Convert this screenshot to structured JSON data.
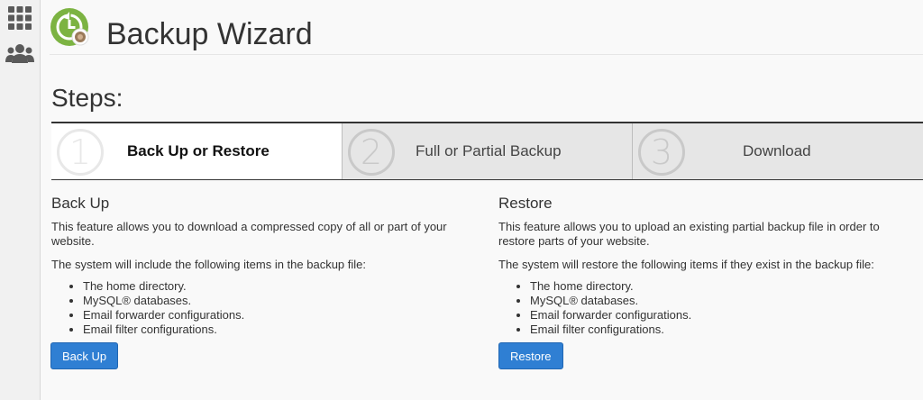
{
  "header": {
    "title": "Backup Wizard"
  },
  "sidebar": {
    "icons": [
      "apps-grid-icon",
      "users-icon"
    ]
  },
  "steps": {
    "title": "Steps:",
    "items": [
      {
        "number": "1",
        "label": "Back Up or Restore",
        "active": true
      },
      {
        "number": "2",
        "label": "Full or Partial Backup",
        "active": false
      },
      {
        "number": "3",
        "label": "Download",
        "active": false
      }
    ]
  },
  "backup": {
    "title": "Back Up",
    "description": "This feature allows you to download a compressed copy of all or part of your website.",
    "intro": "The system will include the following items in the backup file:",
    "items": [
      "The home directory.",
      "MySQL® databases.",
      "Email forwarder configurations.",
      "Email filter configurations."
    ],
    "button": "Back Up"
  },
  "restore": {
    "title": "Restore",
    "description": "This feature allows you to upload an existing partial backup file in order to restore parts of your website.",
    "intro": "The system will restore the following items if they exist in the backup file:",
    "items": [
      "The home directory.",
      "MySQL® databases.",
      "Email forwarder configurations.",
      "Email filter configurations."
    ],
    "button": "Restore"
  },
  "colors": {
    "accent": "#2f7fd3",
    "logo_green": "#7cb342"
  }
}
